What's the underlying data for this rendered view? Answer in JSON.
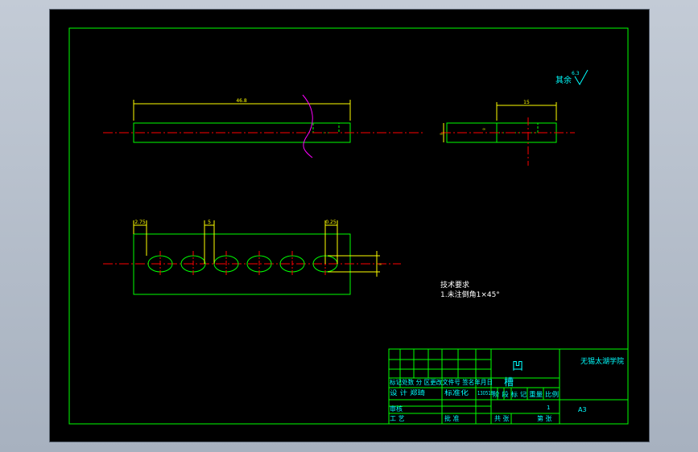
{
  "drawing": {
    "roughness": {
      "label": "其余",
      "value": "6.3"
    },
    "top_view": {
      "length_dim": "46.8"
    },
    "side_view": {
      "width_dim": "15",
      "height_dim": "∞",
      "small_dim": "∞"
    },
    "front_view": {
      "dim_left": "2.75",
      "dim_gap": "5",
      "dim_right": "0.25",
      "dim_vertical": "∞"
    },
    "notes": {
      "title": "技术要求",
      "line1": "1.未注倒角1×45°"
    },
    "title_block": {
      "part_name": "凹",
      "part_name_2": "槽",
      "school": "无锡太湖学院",
      "paper_size": "A3",
      "row_headers": "标记处数 分 区更改文件号 签名年月日",
      "designer_row": "设 计 郑琦",
      "standard_label": "标准化",
      "code": "130518",
      "stage_header": "阶 段 标 记 重量 比例",
      "scale": "1",
      "check_label": "审核",
      "process_label": "工 艺",
      "approve_label": "批 准",
      "sheet_total": "共 张",
      "sheet_num": "第 张"
    }
  },
  "colors": {
    "outline": "#00ff00",
    "dimension": "#ffff00",
    "centerline": "#ff0000",
    "break_line": "#ff00ff",
    "text": "#00ffff",
    "border": "#ffffff"
  }
}
